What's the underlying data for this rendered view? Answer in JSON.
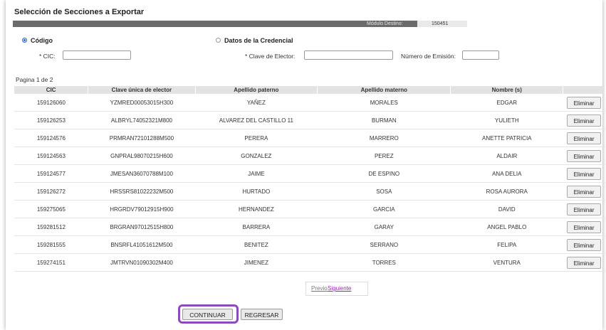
{
  "page": {
    "title": "Selección de Secciones a Exportar",
    "modulo_label": "Módulo Destino:",
    "modulo_value": "150451"
  },
  "search": {
    "option_codigo": "Código",
    "option_credencial": "Datos de la Credencial",
    "cic_label": "* CIC:",
    "clave_label": "* Clave de Elector:",
    "emision_label": "Número de Emisión:",
    "cic_value": "",
    "clave_value": "",
    "emision_value": ""
  },
  "pagination_text": "Pagina 1 de 2",
  "table": {
    "headers": [
      "CIC",
      "Clave única de elector",
      "Apellido paterno",
      "Apellido materno",
      "Nombre (s)",
      ""
    ],
    "delete_label": "Eliminar",
    "rows": [
      [
        "159126060",
        "YZMRED00053015H300",
        "YAÑEZ",
        "MORALES",
        "EDGAR"
      ],
      [
        "159126253",
        "ALBRYL74052321M800",
        "ALVAREZ DEL CASTILLO 11",
        "BURMAN",
        "YULIETH"
      ],
      [
        "159124576",
        "PRMRAN72101288M500",
        "PERERA",
        "MARRERO",
        "ANETTE PATRICIA"
      ],
      [
        "159124563",
        "GNPRAL98070215H600",
        "GONZALEZ",
        "PEREZ",
        "ALDAIR"
      ],
      [
        "159124577",
        "JMESAN36070788M100",
        "JAIME",
        "DE ESPINO",
        "ANA DELIA"
      ],
      [
        "159126272",
        "HRSSRS81022232M500",
        "HURTADO",
        "SOSA",
        "ROSA AURORA"
      ],
      [
        "159275065",
        "HRGRDV79012915H900",
        "HERNANDEZ",
        "GARCIA",
        "DAVID"
      ],
      [
        "159281512",
        "BRGRAN97012515H800",
        "BARRERA",
        "GARAY",
        "ANGEL PABLO"
      ],
      [
        "159281555",
        "BNSRFL41051612M500",
        "BENITEZ",
        "SERRANO",
        "FELIPA"
      ],
      [
        "159274151",
        "JMTRVN01090302M400",
        "JIMENEZ",
        "TORRES",
        "VENTURA"
      ]
    ]
  },
  "pager": {
    "prev": "Previo",
    "next": "Siguiente"
  },
  "actions": {
    "continue": "CONTINUAR",
    "back": "REGRESAR"
  },
  "colors": {
    "highlight": "#8a4bbd",
    "radio_selected": "#1a6fd9",
    "link_visited": "#9b1fb3"
  }
}
